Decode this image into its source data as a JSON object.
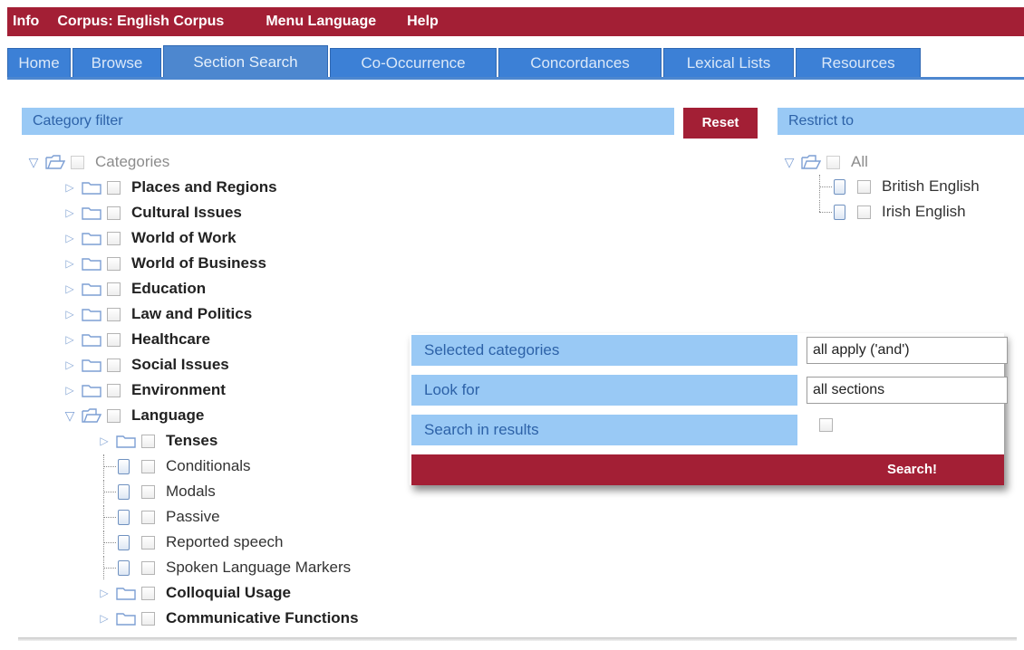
{
  "top_menu": [
    "Info",
    "Corpus: English Corpus",
    "Menu Language",
    "Help"
  ],
  "tabs": [
    {
      "label": "Home",
      "active": false
    },
    {
      "label": "Browse",
      "active": false
    },
    {
      "label": "Section Search",
      "active": true
    },
    {
      "label": "Co-Occurrence",
      "active": false
    },
    {
      "label": "Concordances",
      "active": false
    },
    {
      "label": "Lexical Lists",
      "active": false
    },
    {
      "label": "Resources",
      "active": false
    }
  ],
  "category_filter": {
    "title": "Category filter",
    "reset_label": "Reset",
    "tree": {
      "root": "Categories",
      "items": [
        {
          "label": "Places and Regions",
          "expanded": false
        },
        {
          "label": "Cultural Issues",
          "expanded": false
        },
        {
          "label": "World of Work",
          "expanded": false
        },
        {
          "label": "World of Business",
          "expanded": false
        },
        {
          "label": "Education",
          "expanded": false
        },
        {
          "label": "Law and Politics",
          "expanded": false
        },
        {
          "label": "Healthcare",
          "expanded": false
        },
        {
          "label": "Social Issues",
          "expanded": false
        },
        {
          "label": "Environment",
          "expanded": false
        },
        {
          "label": "Language",
          "expanded": true
        }
      ],
      "language_children": [
        {
          "label": "Tenses",
          "type": "folder"
        },
        {
          "label": "Conditionals",
          "type": "leaf"
        },
        {
          "label": "Modals",
          "type": "leaf"
        },
        {
          "label": "Passive",
          "type": "leaf"
        },
        {
          "label": "Reported speech",
          "type": "leaf"
        },
        {
          "label": "Spoken Language Markers",
          "type": "leaf"
        },
        {
          "label": "Colloquial Usage",
          "type": "folder"
        },
        {
          "label": "Communicative Functions",
          "type": "folder"
        }
      ]
    }
  },
  "restrict_to": {
    "title": "Restrict to",
    "root": "All",
    "items": [
      "British English",
      "Irish English"
    ]
  },
  "search_panel": {
    "selected_categories_label": "Selected categories",
    "selected_categories_value": "all apply ('and')",
    "look_for_label": "Look for",
    "look_for_value": "all sections",
    "search_in_results_label": "Search in results",
    "search_button": "Search!"
  },
  "colors": {
    "brand_red": "#a31f35",
    "tab_blue": "#3c80d6",
    "header_light_blue": "#99c9f5",
    "header_text_blue": "#2d62a8"
  }
}
